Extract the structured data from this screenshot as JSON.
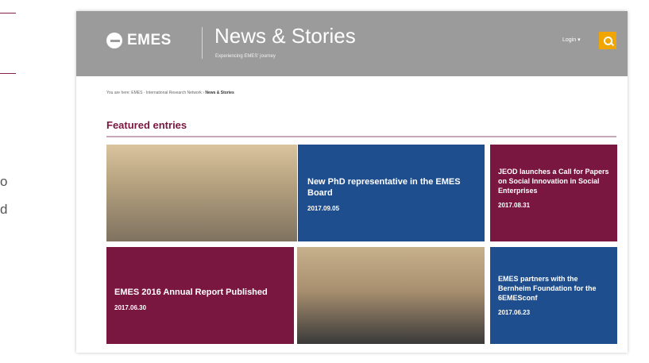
{
  "left_fragments": {
    "line1": "",
    "text1": "o",
    "text2": "d"
  },
  "header": {
    "logo_text": "EMES",
    "site_title": "News & Stories",
    "site_subtitle": "Experiencing EMES' journey",
    "login_label": "Login ▾"
  },
  "breadcrumb": {
    "prefix": "You are here: EMES · International Research Network ›",
    "current": "News & Stories"
  },
  "section": {
    "title": "Featured entries"
  },
  "entries": [
    {
      "title": "New PhD representative in the EMES Board",
      "date": "2017.09.05"
    },
    {
      "title": "JEOD launches a Call for Papers on Social Innovation in Social Enterprises",
      "date": "2017.08.31"
    },
    {
      "title": "EMES 2016 Annual Report Published",
      "date": "2017.06.30"
    },
    {
      "title": "EMES partners with the Bernheim Foundation for the 6EMESconf",
      "date": "2017.06.23"
    }
  ],
  "colors": {
    "header_bg": "#9b9b9b",
    "accent_maroon": "#7a1741",
    "accent_blue": "#1f4e8e",
    "search_yellow": "#f0a500"
  }
}
